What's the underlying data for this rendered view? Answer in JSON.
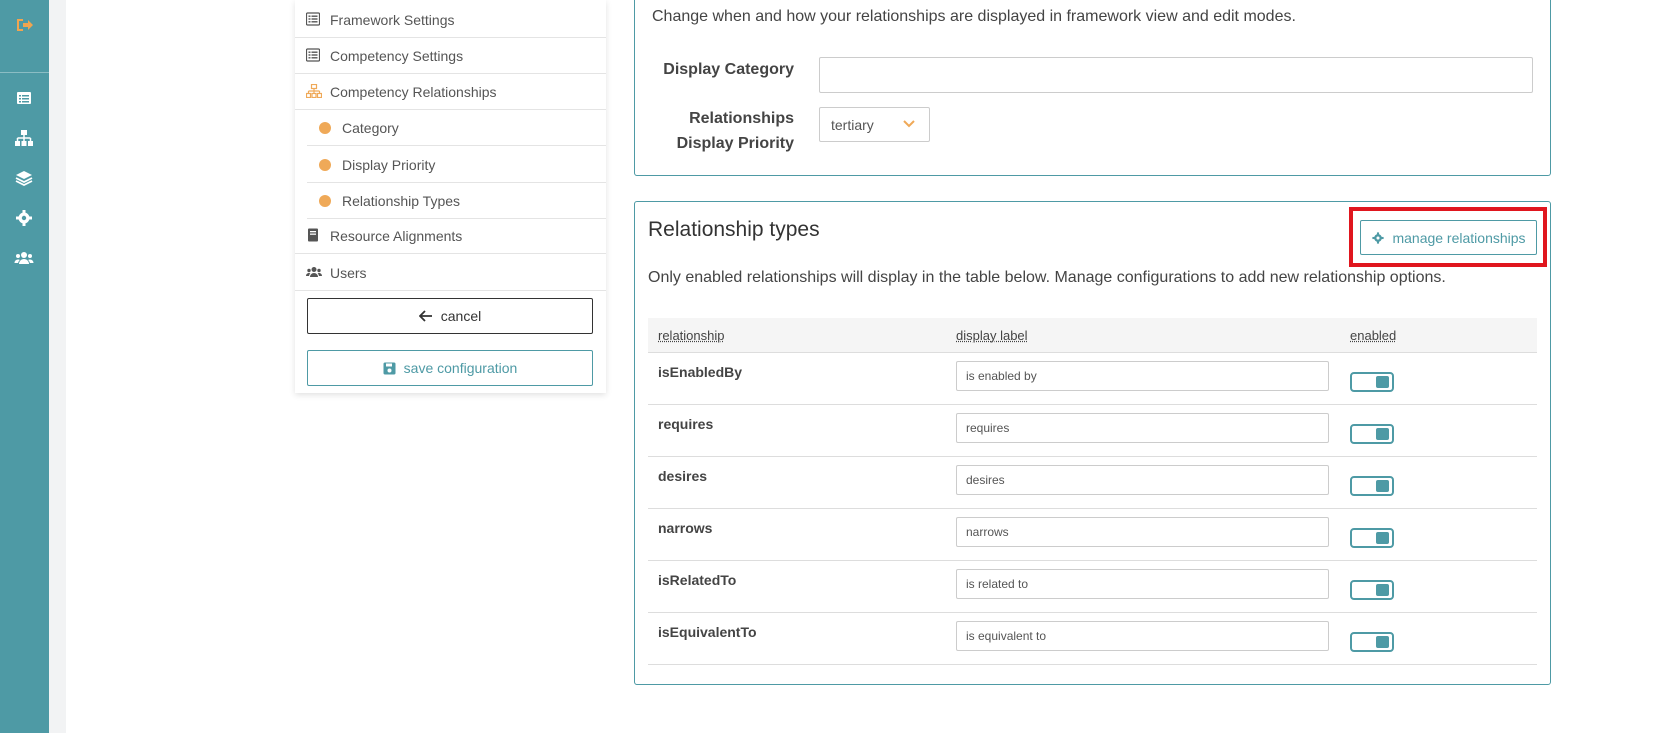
{
  "rail": {
    "icons": [
      "logout-icon",
      "list-icon",
      "sitemap-icon",
      "layers-icon",
      "gear-icon",
      "users-icon"
    ],
    "color": "#4e9aa5"
  },
  "nav": {
    "items": [
      {
        "label": "Framework Settings",
        "icon": "list-icon"
      },
      {
        "label": "Competency Settings",
        "icon": "list-icon"
      },
      {
        "label": "Competency Relationships",
        "icon": "sitemap-icon"
      },
      {
        "label": "Category",
        "icon": "dot"
      },
      {
        "label": "Display Priority",
        "icon": "dot"
      },
      {
        "label": "Relationship Types",
        "icon": "dot"
      },
      {
        "label": "Resource Alignments",
        "icon": "book-icon"
      },
      {
        "label": "Users",
        "icon": "users-icon"
      }
    ],
    "cancel_label": "cancel",
    "save_label": "save configuration"
  },
  "display": {
    "description": "Change when and how your relationships are displayed in framework view and edit modes.",
    "category_label": "Display Category",
    "category_value": "",
    "priority_label_line1": "Relationships",
    "priority_label_line2": "Display Priority",
    "priority_value": "tertiary"
  },
  "relationship_types": {
    "title": "Relationship types",
    "manage_label": "manage relationships",
    "description": "Only enabled relationships will display in the table below. Manage configurations to add new relationship options.",
    "columns": [
      "relationship",
      "display label",
      "enabled"
    ],
    "rows": [
      {
        "relationship": "isEnabledBy",
        "display_label": "is enabled by",
        "enabled": true
      },
      {
        "relationship": "requires",
        "display_label": "requires",
        "enabled": true
      },
      {
        "relationship": "desires",
        "display_label": "desires",
        "enabled": true
      },
      {
        "relationship": "narrows",
        "display_label": "narrows",
        "enabled": true
      },
      {
        "relationship": "isRelatedTo",
        "display_label": "is related to",
        "enabled": true
      },
      {
        "relationship": "isEquivalentTo",
        "display_label": "is equivalent to",
        "enabled": true
      }
    ]
  },
  "colors": {
    "accent": "#4e9aa5",
    "orange": "#efa958",
    "highlight": "#e0161e"
  }
}
